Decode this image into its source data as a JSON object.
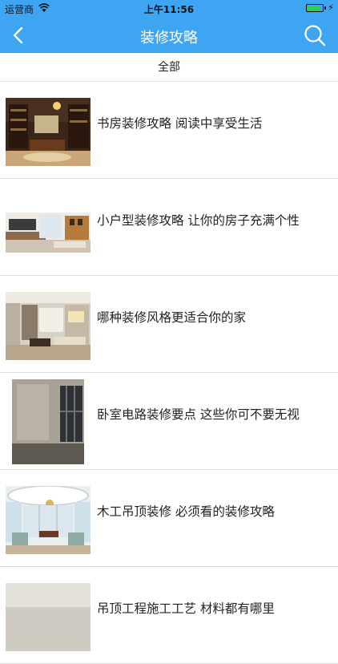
{
  "status_bar": {
    "carrier": "运营商",
    "time": "上午11:56",
    "wifi_icon": "wifi-icon",
    "battery_icon": "battery-icon",
    "battery_level": 0.9
  },
  "nav": {
    "title": "装修攻略",
    "back_icon": "chevron-left-icon",
    "search_icon": "search-icon",
    "bar_color": "#3ea5f3"
  },
  "category": {
    "label": "全部"
  },
  "articles": [
    {
      "title": "书房装修攻略 阅读中享受生活"
    },
    {
      "title": "小户型装修攻略 让你的房子充满个性"
    },
    {
      "title": "哪种装修风格更适合你的家"
    },
    {
      "title": "卧室电路装修要点 这些你可不要无视"
    },
    {
      "title": "木工吊顶装修 必须看的装修攻略"
    },
    {
      "title": "吊顶工程施工工艺 材料都有哪里"
    }
  ]
}
